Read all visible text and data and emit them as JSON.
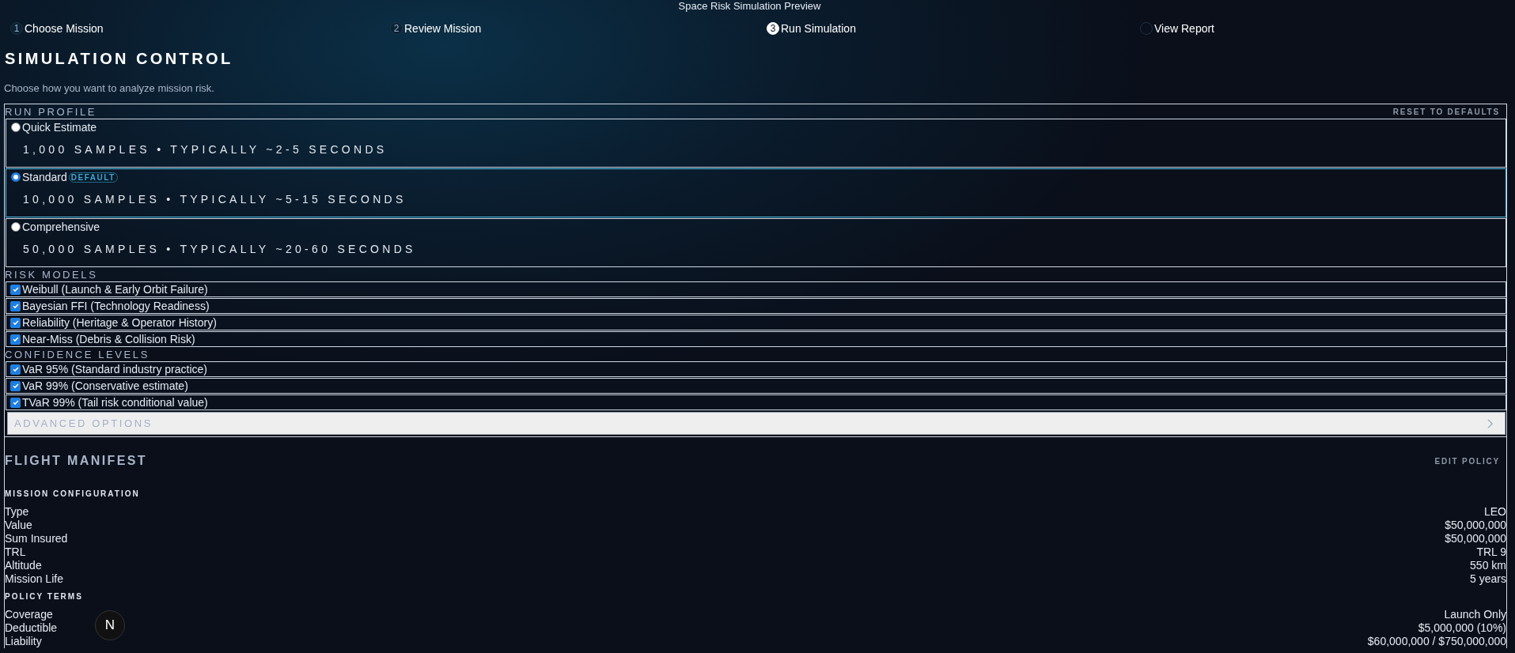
{
  "app_title": "Space Risk Simulation Preview",
  "steps": [
    {
      "number": "1",
      "label": "Choose Mission",
      "completed": true,
      "selected": false
    },
    {
      "number": "2",
      "label": "Review Mission",
      "completed": true,
      "selected": false
    },
    {
      "number": "3",
      "label": "Run Simulation",
      "completed": false,
      "selected": true
    },
    {
      "label": "View Report",
      "completed": false,
      "selected": false
    }
  ],
  "page_title": "SIMULATION CONTROL",
  "page_subtitle": "Choose how you want to analyze mission risk.",
  "run_profile": {
    "heading": "RUN PROFILE",
    "reset_link": "RESET TO DEFAULTS",
    "options": [
      {
        "label": "Quick Estimate",
        "detail": "1,000 SAMPLES • TYPICALLY ~2-5 SECONDS",
        "selected": false
      },
      {
        "label": "Standard",
        "badge": "DEFAULT",
        "detail": "10,000 SAMPLES • TYPICALLY ~5-15 SECONDS",
        "selected": true
      },
      {
        "label": "Comprehensive",
        "detail": "50,000 SAMPLES • TYPICALLY ~20-60 SECONDS",
        "selected": false
      }
    ]
  },
  "risk_models": {
    "heading": "RISK MODELS",
    "items": [
      {
        "label": "Weibull (Launch & Early Orbit Failure)",
        "checked": true
      },
      {
        "label": "Bayesian FFI (Technology Readiness)",
        "checked": true
      },
      {
        "label": "Reliability (Heritage & Operator History)",
        "checked": true
      },
      {
        "label": "Near-Miss (Debris & Collision Risk)",
        "checked": true
      }
    ]
  },
  "confidence_levels": {
    "heading": "CONFIDENCE LEVELS",
    "items": [
      {
        "label": "VaR 95% (Standard industry practice)",
        "checked": true
      },
      {
        "label": "VaR 99% (Conservative estimate)",
        "checked": true
      },
      {
        "label": "TVaR 99% (Tail risk conditional value)",
        "checked": true
      }
    ]
  },
  "advanced_options": {
    "label": "ADVANCED OPTIONS",
    "expanded": false
  },
  "flight_manifest": {
    "heading": "FLIGHT MANIFEST",
    "edit_link": "EDIT POLICY",
    "sections": [
      {
        "heading": "MISSION CONFIGURATION",
        "rows": [
          {
            "label": "Type",
            "value": "LEO"
          },
          {
            "label": "Value",
            "value": "$50,000,000"
          },
          {
            "label": "Sum Insured",
            "value": "$50,000,000"
          },
          {
            "label": "TRL",
            "value": "TRL 9"
          },
          {
            "label": "Altitude",
            "value": "550 km"
          },
          {
            "label": "Mission Life",
            "value": "5 years"
          }
        ]
      },
      {
        "heading": "POLICY TERMS",
        "rows": [
          {
            "label": "Coverage",
            "value": "Launch Only"
          },
          {
            "label": "Deductible",
            "value": "$5,000,000 (10%)"
          },
          {
            "label": "Liability",
            "value": "$60,000,000 / $750,000,000"
          }
        ]
      }
    ]
  },
  "dev_badge": {
    "letter": "N"
  }
}
